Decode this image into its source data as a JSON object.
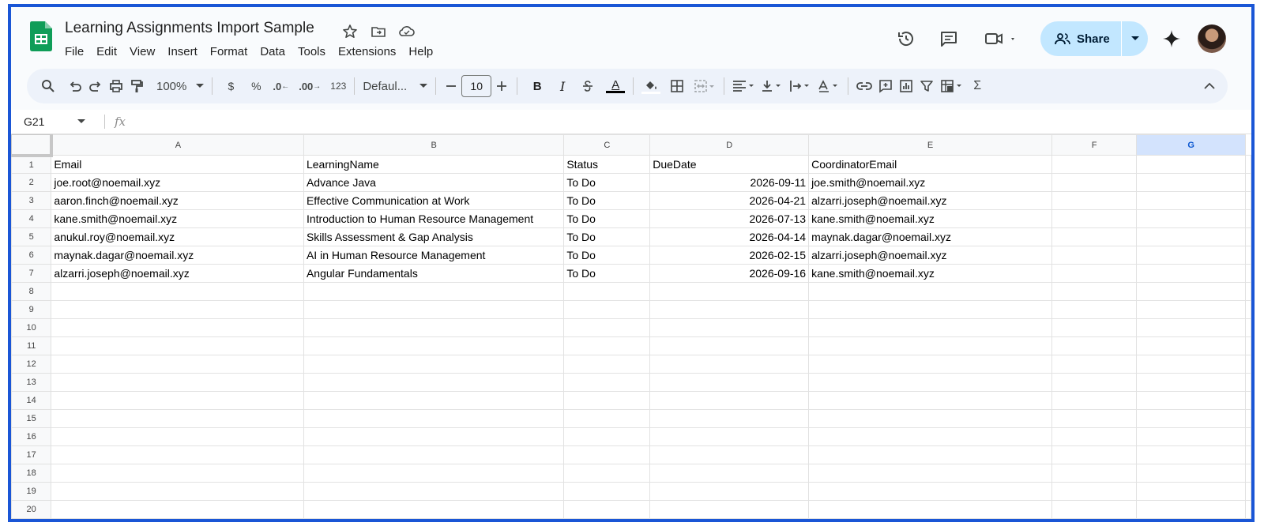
{
  "document": {
    "title": "Learning Assignments Import Sample"
  },
  "menu": [
    "File",
    "Edit",
    "View",
    "Insert",
    "Format",
    "Data",
    "Tools",
    "Extensions",
    "Help"
  ],
  "header": {
    "share_label": "Share"
  },
  "toolbar": {
    "zoom": "100%",
    "currency": "$",
    "percent": "%",
    "dec_decrease": ".0",
    "dec_increase": ".00",
    "number_format": "123",
    "font": "Defaul...",
    "font_size": "10",
    "bold": "B",
    "italic": "I",
    "text_color_glyph": "A",
    "sum_glyph": "Σ"
  },
  "formula_bar": {
    "cell_ref": "G21",
    "fx": "fx",
    "value": ""
  },
  "grid": {
    "columns": [
      "A",
      "B",
      "C",
      "D",
      "E",
      "F",
      "G"
    ],
    "selected_column": "G",
    "row_numbers": [
      "1",
      "2",
      "3",
      "4",
      "5",
      "6",
      "7",
      "8",
      "9",
      "10",
      "11",
      "12",
      "13",
      "14",
      "15",
      "16",
      "17",
      "18",
      "19",
      "20"
    ],
    "rows": [
      [
        "Email",
        "LearningName",
        "Status",
        "DueDate",
        "CoordinatorEmail",
        "",
        ""
      ],
      [
        "joe.root@noemail.xyz",
        "Advance Java",
        "To Do",
        "2026-09-11",
        "joe.smith@noemail.xyz",
        "",
        ""
      ],
      [
        "aaron.finch@noemail.xyz",
        "Effective Communication at Work",
        "To Do",
        "2026-04-21",
        "alzarri.joseph@noemail.xyz",
        "",
        ""
      ],
      [
        "kane.smith@noemail.xyz",
        "Introduction to Human Resource Management",
        "To Do",
        "2026-07-13",
        "kane.smith@noemail.xyz",
        "",
        ""
      ],
      [
        "anukul.roy@noemail.xyz",
        "Skills Assessment & Gap Analysis",
        "To Do",
        "2026-04-14",
        "maynak.dagar@noemail.xyz",
        "",
        ""
      ],
      [
        "maynak.dagar@noemail.xyz",
        "AI in Human Resource Management",
        "To Do",
        "2026-02-15",
        "alzarri.joseph@noemail.xyz",
        "",
        ""
      ],
      [
        "alzarri.joseph@noemail.xyz",
        "Angular Fundamentals",
        "To Do",
        "2026-09-16",
        "kane.smith@noemail.xyz",
        "",
        ""
      ]
    ]
  },
  "colors": {
    "frame": "#1a56d6",
    "share_bg": "#c2e7ff",
    "selected_header": "#d3e3fd",
    "sheets_green": "#0f9d58"
  }
}
